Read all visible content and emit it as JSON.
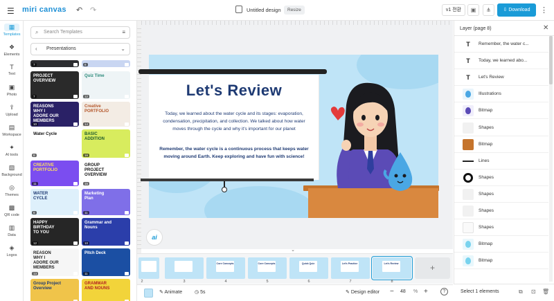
{
  "app": {
    "logo": "miri canvas",
    "doc_title": "Untitled design",
    "resize_label": "Resize",
    "version_label": "v1 전환",
    "download_label": "Download",
    "accent": "#1a9bd7"
  },
  "rail": {
    "items": [
      {
        "label": "Templates",
        "icon": "template-icon"
      },
      {
        "label": "Elements",
        "icon": "elements-icon"
      },
      {
        "label": "Text",
        "icon": "text-icon"
      },
      {
        "label": "Photo",
        "icon": "photo-icon"
      },
      {
        "label": "Upload",
        "icon": "upload-icon"
      },
      {
        "label": "Workspace",
        "icon": "workspace-icon"
      },
      {
        "label": "AI tools",
        "icon": "ai-tools-icon"
      },
      {
        "label": "Background",
        "icon": "background-icon"
      },
      {
        "label": "Themes",
        "icon": "themes-icon"
      },
      {
        "label": "QR code",
        "icon": "qr-icon"
      },
      {
        "label": "Data",
        "icon": "data-icon"
      },
      {
        "label": "Logos",
        "icon": "logos-icon"
      }
    ]
  },
  "templates": {
    "search_placeholder": "Search Templates",
    "category": "Presentations",
    "items": [
      {
        "title": "",
        "num": "7"
      },
      {
        "title": "",
        "num": "8"
      },
      {
        "title": "PROJECT OVERVIEW",
        "num": "7"
      },
      {
        "title": "Quiz Time",
        "num": "12"
      },
      {
        "title": "REASONS WHY I ADORE OUR MEMBERS",
        "num": "10"
      },
      {
        "title": "Creative PORTFOLIO",
        "num": "14"
      },
      {
        "title": "Water Cycle",
        "num": "8"
      },
      {
        "title": "BASIC ADDITION",
        "num": "16"
      },
      {
        "title": "CREATIVE PORTFOLIO",
        "num": "11"
      },
      {
        "title": "GROUP PROJECT OVERVIEW",
        "num": "15"
      },
      {
        "title": "WATER CYCLE",
        "num": "8"
      },
      {
        "title": "Marketing Plan",
        "num": "11"
      },
      {
        "title": "HAPPY BIRTHDAY TO YOU",
        "num": "12"
      },
      {
        "title": "Grammar and Nouns",
        "num": "10"
      },
      {
        "title": "REASON WHY I ADORE OUR MEMBERS",
        "num": "13"
      },
      {
        "title": "Pitch Deck",
        "num": "11"
      },
      {
        "title": "Group Project Overview",
        "num": ""
      },
      {
        "title": "GRAMMAR AND NOUNS",
        "num": ""
      }
    ]
  },
  "slide": {
    "title": "Let's Review",
    "paragraph1": "Today, we learned about the water cycle and its stages: evaporation, condensation, precipitation, and collection. We talked about how water moves through the cycle and why it's important for our planet",
    "paragraph2": "Remember, the water cycle is a continuous process that keeps water moving around Earth. Keep exploring and have fun with science!",
    "background": "#bfe4f7",
    "title_color": "#1e3a73",
    "ai_badge": "ai"
  },
  "filmstrip": {
    "slides": [
      {
        "num": "2",
        "label": ""
      },
      {
        "num": "3",
        "label": ""
      },
      {
        "num": "4",
        "label": "Core Concepts"
      },
      {
        "num": "5",
        "label": "Core Concepts"
      },
      {
        "num": "6",
        "label": "Quick Quiz"
      },
      {
        "num": "7",
        "label": "Let's Practice"
      },
      {
        "num": "8",
        "label": "Let's Review"
      }
    ],
    "add_label": "+"
  },
  "bottombar": {
    "animate_label": "Animate",
    "duration_label": "5s",
    "design_editor_label": "Design editor",
    "zoom_value": "48",
    "zoom_unit": "%",
    "help": "?"
  },
  "layers": {
    "title": "Layer (page 8)",
    "items": [
      {
        "label": "Remember, the water c...",
        "kind": "text"
      },
      {
        "label": "Today, we learned abo...",
        "kind": "text"
      },
      {
        "label": "Let's Review",
        "kind": "text"
      },
      {
        "label": "Illustrations",
        "kind": "droplet"
      },
      {
        "label": "Bitmap",
        "kind": "girl"
      },
      {
        "label": "Shapes",
        "kind": "light"
      },
      {
        "label": "Bitmap",
        "kind": "wood"
      },
      {
        "label": "Lines",
        "kind": "line"
      },
      {
        "label": "Shapes",
        "kind": "circle"
      },
      {
        "label": "Shapes",
        "kind": "light"
      },
      {
        "label": "Shapes",
        "kind": "light"
      },
      {
        "label": "Shapes",
        "kind": "white"
      },
      {
        "label": "Bitmap",
        "kind": "cloud"
      },
      {
        "label": "Bitmap",
        "kind": "cloud"
      }
    ],
    "footer": "Select 1 elements"
  }
}
